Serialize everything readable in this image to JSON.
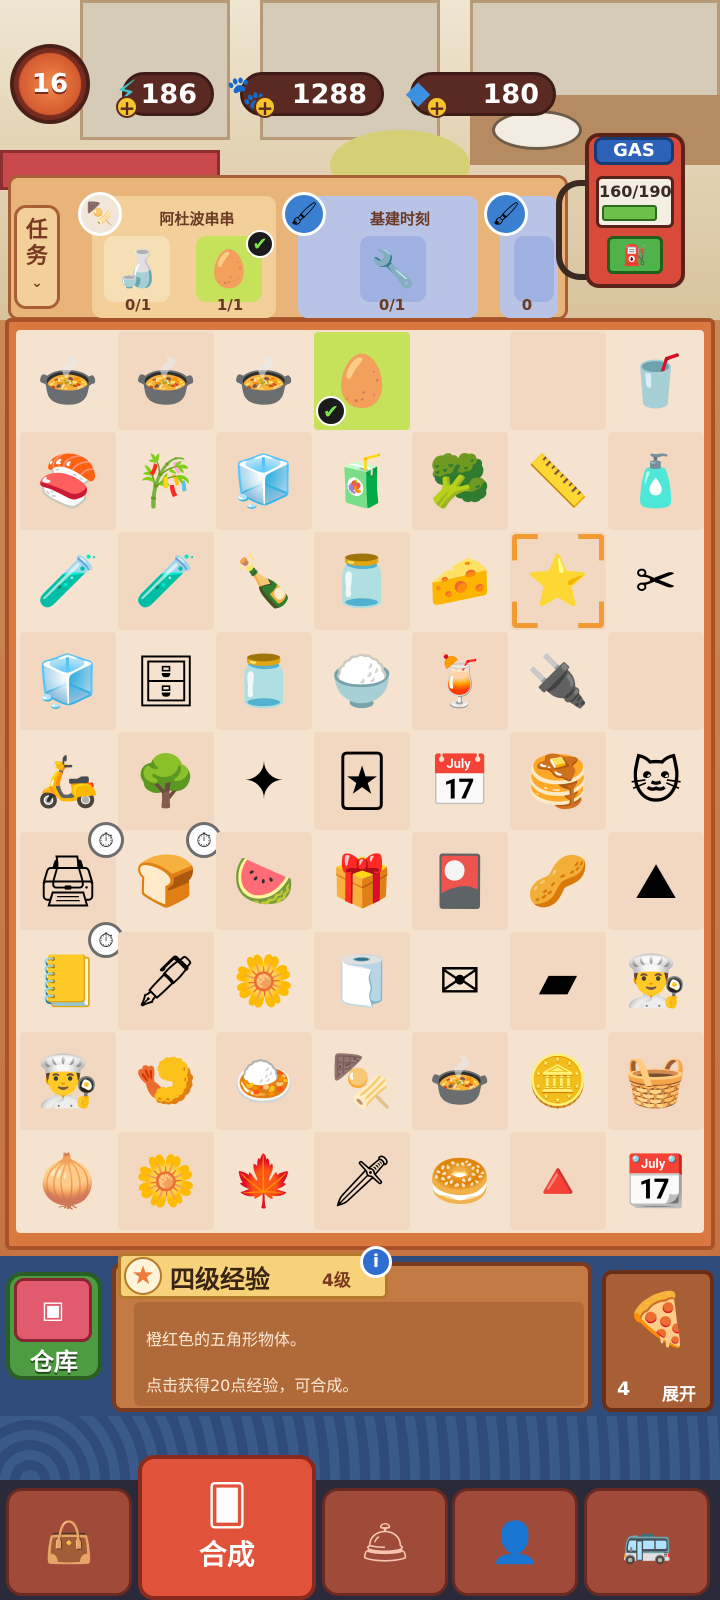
{
  "player": {
    "level": "16"
  },
  "resources": [
    {
      "name": "energy",
      "value": "186",
      "icon": "lightning-icon",
      "color": "#3fc5c9"
    },
    {
      "name": "coins",
      "value": "1288",
      "icon": "paw-coin-icon",
      "color": "#f4b82a"
    },
    {
      "name": "gems",
      "value": "180",
      "icon": "diamond-icon",
      "color": "#3d8fe0"
    }
  ],
  "tasks": {
    "tab_label_top": "任",
    "tab_label_bottom": "务",
    "cards": [
      {
        "title": "阿杜波串串",
        "requirements": [
          {
            "icon": "sauce-bottle-icon",
            "count": "0/1",
            "done": false
          },
          {
            "icon": "egg-yolk-icon",
            "count": "1/1",
            "done": true
          }
        ]
      },
      {
        "title": "基建时刻",
        "requirements": [
          {
            "icon": "pliers-icon",
            "count": "0/1",
            "done": false
          }
        ]
      },
      {
        "title": "",
        "requirements": [
          {
            "icon": "partial-item-icon",
            "count": "0",
            "done": false
          }
        ]
      }
    ]
  },
  "gas": {
    "label": "GAS",
    "reading": "160/190",
    "fill": 0.84
  },
  "board": {
    "rows": [
      [
        "pot-skewers-icon",
        "pot-skewers-icon",
        "pot-skewers-icon",
        "egg-yolk-icon",
        "",
        "",
        "cup-icon"
      ],
      [
        "sushi-roll-icon",
        "sugarcane-icon",
        "sugar-cubes-icon",
        "gum-pack-icon",
        "broccoli-icon",
        "tape-measure-icon",
        "glue-bottle-icon"
      ],
      [
        "shelf-bottles-icon",
        "shelf-bottles-icon",
        "soy-sauce-icon",
        "jam-jar-icon",
        "cheese-icon",
        "star-icon",
        "scissors-icon"
      ],
      [
        "fridge-icon",
        "safe-icon",
        "jar-icon",
        "rice-plate-icon",
        "drink-cup-icon",
        "power-box-icon",
        ""
      ],
      [
        "delivery-bike-icon",
        "bonsai-icon",
        "sparkle-icon",
        "skewer-cards-icon",
        "calendar-clock-icon",
        "pancake-icon",
        "lucky-cat-icon"
      ],
      [
        "printer-icon",
        "toaster-icon",
        "watermelon-icon",
        "gift-box-icon",
        "skewer-card-icon",
        "nuts-paper-icon",
        "metal-ore-icon"
      ],
      [
        "notebook-icon",
        "fountain-pen-icon",
        "flower-card-icon",
        "napkin-icon",
        "envelope-icon",
        "metal-sheet-icon",
        "chef-hat-icon"
      ],
      [
        "chef-hat-icon",
        "shrimp-bowl-icon",
        "rice-plate-chicken-icon",
        "grilled-skewers-icon",
        "stew-pot-icon",
        "silver-bars-icon",
        "towel-icon"
      ],
      [
        "onion-doll-icon",
        "yellow-flower-icon",
        "maple-wreath-icon",
        "kunai-icon",
        "bread-roll-icon",
        "spinning-top-icon",
        "june-calendar-icon"
      ]
    ],
    "selected": {
      "row": 0,
      "col": 3
    },
    "highlighted": {
      "row": 2,
      "col": 5
    },
    "timers": [
      {
        "row": 5,
        "col": 0
      },
      {
        "row": 5,
        "col": 1
      },
      {
        "row": 6,
        "col": 0
      }
    ]
  },
  "info": {
    "name": "四级经验",
    "level": "4级",
    "description": "橙红色的五角形物体。",
    "hint": "点击获得20点经验，可合成。"
  },
  "storage": {
    "label": "仓库"
  },
  "preview": {
    "count": "4",
    "expand_label": "展开"
  },
  "nav": [
    {
      "name": "bag",
      "icon": "shopping-bag-icon"
    },
    {
      "name": "merge",
      "icon": "cards-icon",
      "label": "合成"
    },
    {
      "name": "dish",
      "icon": "cloche-icon"
    },
    {
      "name": "profile",
      "icon": "portrait-icon"
    },
    {
      "name": "bus",
      "icon": "bus-icon"
    }
  ]
}
